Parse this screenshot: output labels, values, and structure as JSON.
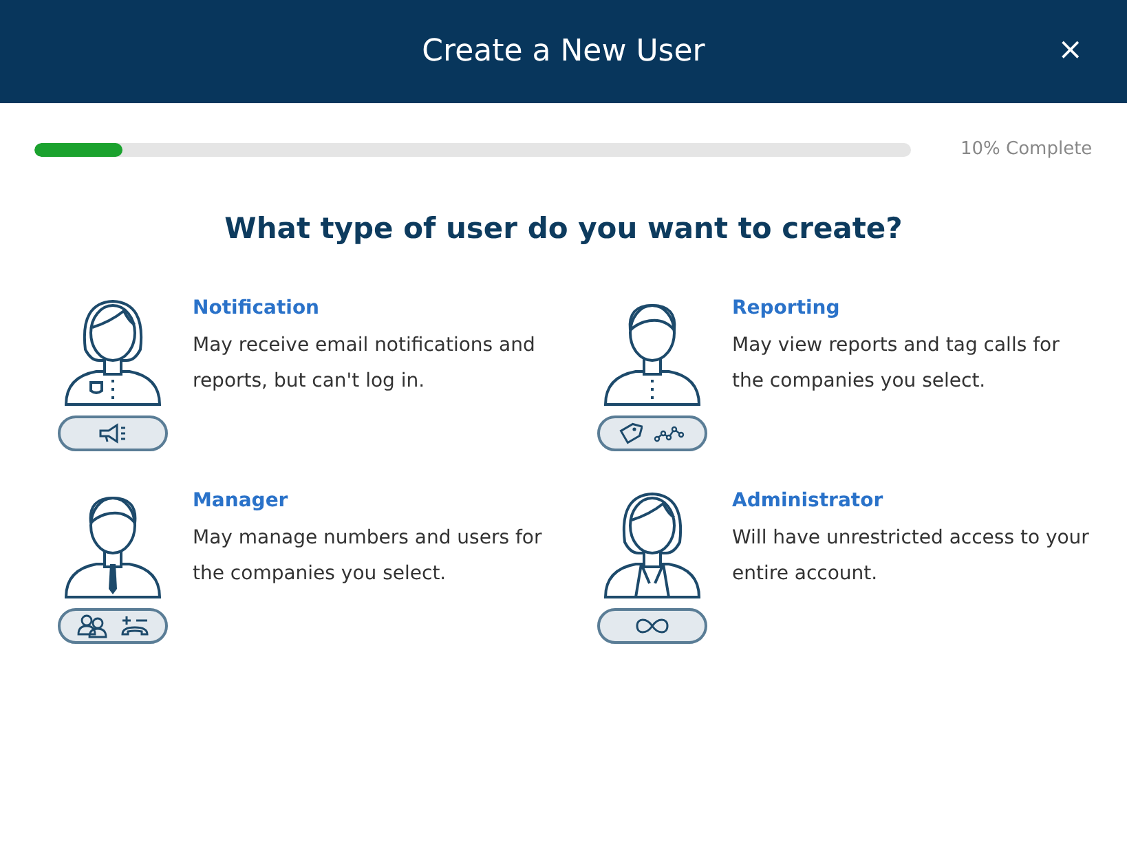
{
  "window": {
    "title": "Create a New User",
    "close": "×"
  },
  "progress": {
    "level": 0.1,
    "reading": "10% Complete"
  },
  "question": "What type of user do you want to create?",
  "options": [
    {
      "kind": "notification",
      "title": "Notification",
      "description": "May receive email notifications and reports, but can't log in."
    },
    {
      "kind": "reporting",
      "title": "Reporting",
      "description": "May view reports and tag calls for the companies you select."
    },
    {
      "kind": "manager",
      "title": "Manager",
      "description": "May manage numbers and users for the companies you select."
    },
    {
      "kind": "administrator",
      "title": "Administrator",
      "description": "Will have unrestricted access to your entire account."
    }
  ]
}
